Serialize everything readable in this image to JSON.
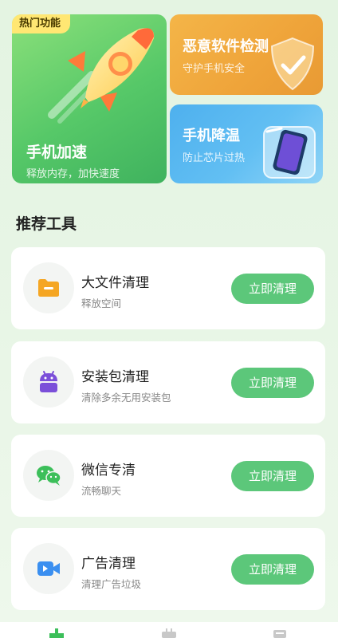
{
  "features": {
    "hot_badge": "热门功能",
    "phone_boost": {
      "title": "手机加速",
      "subtitle": "释放内存，加快速度"
    },
    "malware_scan": {
      "title": "恶意软件检测",
      "subtitle": "守护手机安全"
    },
    "phone_cool": {
      "title": "手机降温",
      "subtitle": "防止芯片过热"
    }
  },
  "section": {
    "title": "推荐工具"
  },
  "tools": [
    {
      "name": "大文件清理",
      "desc": "释放空间",
      "button": "立即清理",
      "icon": "folder-icon",
      "color": "#f5a623"
    },
    {
      "name": "安装包清理",
      "desc": "清除多余无用安装包",
      "button": "立即清理",
      "icon": "android-icon",
      "color": "#7b4fd9"
    },
    {
      "name": "微信专清",
      "desc": "流畅聊天",
      "button": "立即清理",
      "icon": "wechat-icon",
      "color": "#3cbf5a"
    },
    {
      "name": "广告清理",
      "desc": "清理广告垃圾",
      "button": "立即清理",
      "icon": "video-icon",
      "color": "#3a8ff0"
    }
  ],
  "colors": {
    "accent_green": "#5cc77a",
    "card_green": "#56c868",
    "card_orange": "#efa43a",
    "card_blue": "#62bff3",
    "badge_yellow": "#ffe773"
  },
  "nav": [
    "home-icon",
    "tool-icon",
    "file-icon"
  ]
}
